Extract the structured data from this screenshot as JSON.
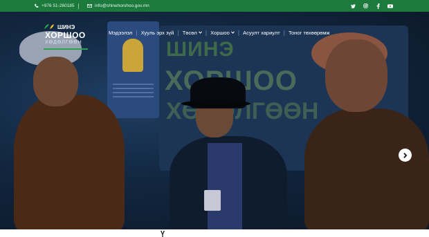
{
  "topbar": {
    "phone": "+976 51-260185",
    "email": "info@shinehorshoo.gov.mn",
    "socials": [
      "twitter-icon",
      "instagram-icon",
      "facebook-icon",
      "youtube-icon"
    ]
  },
  "logo": {
    "line1": "ШИНЭ",
    "line2": "ХОРШОО",
    "line3": "ХӨДӨЛГӨӨН"
  },
  "nav": [
    {
      "label": "Мэдээлэл",
      "dropdown": false
    },
    {
      "label": "Хууль эрх зүй",
      "dropdown": false
    },
    {
      "label": "Төсөл",
      "dropdown": true
    },
    {
      "label": "Хоршоо",
      "dropdown": true
    },
    {
      "label": "Асуулт хариулт",
      "dropdown": false
    },
    {
      "label": "Тоног төхөөрөмж",
      "dropdown": false
    }
  ],
  "hero": {
    "board_line1": "ШИНЭ",
    "board_line2": "ХОРШОО",
    "board_line3": "ХӨДӨЛГӨӨН"
  },
  "colors": {
    "accent": "#1b7a3c",
    "hero_bg": "#12263f"
  }
}
